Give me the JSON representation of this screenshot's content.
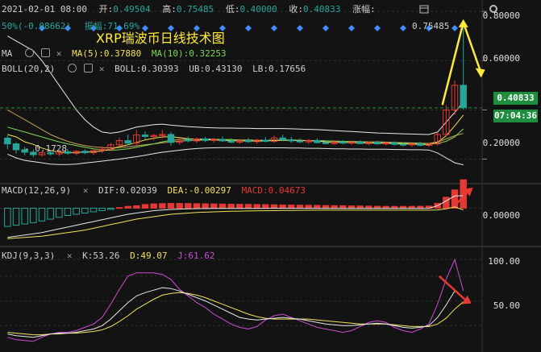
{
  "header": {
    "date": "2021-02-01 08:00",
    "open_label": "开:",
    "open_value": "0.49504",
    "high_label": "高:",
    "high_value": "0.75485",
    "low_label": "低:",
    "low_value": "0.40000",
    "close_label": "收:",
    "close_value": "0.40833",
    "change_label": "涨幅:",
    "change_pct": "50%(-0.08662)",
    "amplitude": "振幅:71.69%"
  },
  "title": "XRP瑞波币日线技术图",
  "ma_row": {
    "label": "MA",
    "ma5": "MA(5):0.37880",
    "ma10": "MA(10):0.32253"
  },
  "boll_row": {
    "label": "BOLL(20,2)",
    "boll": "BOLL:0.30393",
    "ub": "UB:0.43130",
    "lb": "LB:0.17656"
  },
  "macd_row": {
    "label": "MACD(12,26,9)",
    "dif": "DIF:0.02039",
    "dea": "DEA:-0.00297",
    "macd": "MACD:0.04673"
  },
  "kdj_row": {
    "label": "KDJ(9,3,3)",
    "k": "K:53.26",
    "d": "D:49.07",
    "j": "J:61.62"
  },
  "annotations": {
    "high_marker": "0.75485",
    "low_marker": "0.1728"
  },
  "price_tag": {
    "price": "0.40833",
    "countdown": "07:04:36"
  },
  "colors": {
    "up": "#e53935",
    "down": "#26a69a",
    "green_box": "#1e8e3e",
    "yellow": "#ffeb3b",
    "red_arrow": "#e53935"
  },
  "chart_data": [
    {
      "type": "candlestick",
      "title": "XRP瑞波币日线技术图",
      "y_ticks": [
        0.8,
        0.6,
        0.4,
        0.2
      ],
      "y_tick_labels": [
        "0.80000",
        "0.60000",
        "0.40000",
        "0.20000"
      ],
      "ylim": [
        0.12,
        0.82
      ],
      "candles": [
        [
          0.285,
          0.295,
          0.24,
          0.262
        ],
        [
          0.262,
          0.268,
          0.222,
          0.238
        ],
        [
          0.238,
          0.25,
          0.215,
          0.228
        ],
        [
          0.228,
          0.24,
          0.208,
          0.218
        ],
        [
          0.218,
          0.232,
          0.21,
          0.226
        ],
        [
          0.226,
          0.238,
          0.214,
          0.221
        ],
        [
          0.221,
          0.233,
          0.212,
          0.23
        ],
        [
          0.23,
          0.242,
          0.218,
          0.224
        ],
        [
          0.224,
          0.236,
          0.215,
          0.232
        ],
        [
          0.232,
          0.24,
          0.22,
          0.226
        ],
        [
          0.226,
          0.238,
          0.218,
          0.235
        ],
        [
          0.235,
          0.252,
          0.225,
          0.24
        ],
        [
          0.24,
          0.266,
          0.232,
          0.258
        ],
        [
          0.258,
          0.286,
          0.25,
          0.275
        ],
        [
          0.275,
          0.3,
          0.258,
          0.265
        ],
        [
          0.265,
          0.318,
          0.255,
          0.298
        ],
        [
          0.298,
          0.312,
          0.28,
          0.292
        ],
        [
          0.292,
          0.302,
          0.276,
          0.296
        ],
        [
          0.296,
          0.318,
          0.285,
          0.3
        ],
        [
          0.3,
          0.31,
          0.255,
          0.268
        ],
        [
          0.268,
          0.286,
          0.258,
          0.28
        ],
        [
          0.28,
          0.292,
          0.268,
          0.274
        ],
        [
          0.274,
          0.288,
          0.265,
          0.282
        ],
        [
          0.282,
          0.29,
          0.27,
          0.276
        ],
        [
          0.276,
          0.286,
          0.266,
          0.28
        ],
        [
          0.28,
          0.292,
          0.27,
          0.274
        ],
        [
          0.274,
          0.286,
          0.264,
          0.269
        ],
        [
          0.269,
          0.282,
          0.262,
          0.276
        ],
        [
          0.276,
          0.286,
          0.266,
          0.271
        ],
        [
          0.271,
          0.282,
          0.262,
          0.277
        ],
        [
          0.277,
          0.29,
          0.268,
          0.272
        ],
        [
          0.272,
          0.296,
          0.266,
          0.286
        ],
        [
          0.286,
          0.3,
          0.272,
          0.279
        ],
        [
          0.279,
          0.29,
          0.266,
          0.274
        ],
        [
          0.274,
          0.284,
          0.265,
          0.27
        ],
        [
          0.27,
          0.281,
          0.262,
          0.276
        ],
        [
          0.276,
          0.285,
          0.264,
          0.267
        ],
        [
          0.267,
          0.276,
          0.26,
          0.263
        ],
        [
          0.263,
          0.274,
          0.258,
          0.27
        ],
        [
          0.27,
          0.278,
          0.26,
          0.265
        ],
        [
          0.265,
          0.275,
          0.258,
          0.27
        ],
        [
          0.27,
          0.276,
          0.26,
          0.263
        ],
        [
          0.263,
          0.272,
          0.256,
          0.268
        ],
        [
          0.268,
          0.274,
          0.258,
          0.262
        ],
        [
          0.262,
          0.27,
          0.255,
          0.266
        ],
        [
          0.266,
          0.272,
          0.255,
          0.26
        ],
        [
          0.26,
          0.268,
          0.252,
          0.258
        ],
        [
          0.258,
          0.265,
          0.25,
          0.262
        ],
        [
          0.262,
          0.27,
          0.252,
          0.256
        ],
        [
          0.256,
          0.266,
          0.25,
          0.262
        ],
        [
          0.262,
          0.31,
          0.255,
          0.3
        ],
        [
          0.3,
          0.42,
          0.29,
          0.4
        ],
        [
          0.4,
          0.52,
          0.38,
          0.5
        ],
        [
          0.5,
          0.755,
          0.4,
          0.408
        ]
      ],
      "ma5": [
        0.3,
        0.29,
        0.27,
        0.26,
        0.245,
        0.235,
        0.228,
        0.226,
        0.227,
        0.229,
        0.23,
        0.233,
        0.24,
        0.251,
        0.258,
        0.268,
        0.278,
        0.285,
        0.29,
        0.291,
        0.287,
        0.283,
        0.281,
        0.279,
        0.278,
        0.277,
        0.275,
        0.274,
        0.274,
        0.273,
        0.274,
        0.276,
        0.278,
        0.277,
        0.276,
        0.275,
        0.274,
        0.27,
        0.268,
        0.268,
        0.267,
        0.266,
        0.266,
        0.265,
        0.264,
        0.263,
        0.262,
        0.261,
        0.26,
        0.259,
        0.268,
        0.295,
        0.335,
        0.379
      ],
      "ma10": [
        0.33,
        0.32,
        0.31,
        0.3,
        0.29,
        0.28,
        0.27,
        0.262,
        0.255,
        0.248,
        0.242,
        0.238,
        0.236,
        0.238,
        0.242,
        0.248,
        0.255,
        0.262,
        0.27,
        0.276,
        0.279,
        0.281,
        0.282,
        0.282,
        0.281,
        0.28,
        0.279,
        0.277,
        0.276,
        0.275,
        0.275,
        0.275,
        0.276,
        0.276,
        0.276,
        0.275,
        0.275,
        0.274,
        0.273,
        0.272,
        0.271,
        0.27,
        0.269,
        0.268,
        0.267,
        0.266,
        0.265,
        0.264,
        0.263,
        0.262,
        0.264,
        0.272,
        0.29,
        0.323
      ],
      "boll_ub": [
        0.7,
        0.68,
        0.66,
        0.64,
        0.6,
        0.55,
        0.5,
        0.45,
        0.4,
        0.36,
        0.33,
        0.31,
        0.305,
        0.31,
        0.32,
        0.33,
        0.335,
        0.34,
        0.342,
        0.338,
        0.335,
        0.332,
        0.33,
        0.328,
        0.327,
        0.326,
        0.326,
        0.325,
        0.325,
        0.324,
        0.324,
        0.324,
        0.324,
        0.323,
        0.322,
        0.321,
        0.32,
        0.318,
        0.316,
        0.314,
        0.312,
        0.31,
        0.308,
        0.306,
        0.305,
        0.304,
        0.303,
        0.302,
        0.301,
        0.3,
        0.31,
        0.35,
        0.39,
        0.431
      ],
      "boll_mid": [
        0.4,
        0.38,
        0.36,
        0.34,
        0.32,
        0.3,
        0.285,
        0.272,
        0.262,
        0.255,
        0.25,
        0.247,
        0.246,
        0.247,
        0.25,
        0.254,
        0.258,
        0.262,
        0.266,
        0.27,
        0.273,
        0.275,
        0.277,
        0.278,
        0.279,
        0.279,
        0.279,
        0.278,
        0.278,
        0.277,
        0.277,
        0.277,
        0.277,
        0.276,
        0.276,
        0.275,
        0.275,
        0.274,
        0.273,
        0.272,
        0.272,
        0.271,
        0.27,
        0.27,
        0.269,
        0.268,
        0.267,
        0.266,
        0.265,
        0.264,
        0.27,
        0.282,
        0.295,
        0.304
      ],
      "boll_lb": [
        0.22,
        0.205,
        0.195,
        0.19,
        0.185,
        0.18,
        0.178,
        0.178,
        0.18,
        0.184,
        0.188,
        0.192,
        0.196,
        0.2,
        0.205,
        0.21,
        0.216,
        0.222,
        0.228,
        0.232,
        0.236,
        0.24,
        0.243,
        0.245,
        0.246,
        0.247,
        0.247,
        0.247,
        0.247,
        0.246,
        0.246,
        0.246,
        0.246,
        0.245,
        0.245,
        0.244,
        0.244,
        0.243,
        0.242,
        0.242,
        0.241,
        0.241,
        0.24,
        0.24,
        0.24,
        0.239,
        0.239,
        0.238,
        0.238,
        0.237,
        0.225,
        0.205,
        0.185,
        0.177
      ]
    },
    {
      "type": "macd",
      "title": "MACD(12,26,9)",
      "y_ticks": [
        0.0
      ],
      "y_tick_labels": [
        "0.00000"
      ],
      "ylim": [
        -0.055,
        0.035
      ],
      "hist": [
        -0.03,
        -0.028,
        -0.026,
        -0.024,
        -0.021,
        -0.018,
        -0.015,
        -0.012,
        -0.01,
        -0.008,
        -0.006,
        -0.004,
        -0.002,
        0.001,
        0.003,
        0.004,
        0.006,
        0.007,
        0.0075,
        0.0078,
        0.0078,
        0.0076,
        0.0074,
        0.0072,
        0.007,
        0.0068,
        0.0066,
        0.0064,
        0.0062,
        0.006,
        0.0058,
        0.0056,
        0.0054,
        0.0052,
        0.005,
        0.0048,
        0.0046,
        0.0044,
        0.0042,
        0.004,
        0.0038,
        0.0036,
        0.0034,
        0.0032,
        0.003,
        0.003,
        0.003,
        0.003,
        0.0032,
        0.0035,
        0.008,
        0.018,
        0.03,
        0.0467
      ],
      "dif": [
        -0.048,
        -0.046,
        -0.044,
        -0.042,
        -0.04,
        -0.037,
        -0.034,
        -0.031,
        -0.028,
        -0.025,
        -0.022,
        -0.019,
        -0.016,
        -0.013,
        -0.01,
        -0.008,
        -0.006,
        -0.004,
        -0.003,
        -0.002,
        -0.0015,
        -0.001,
        -0.0008,
        -0.0006,
        -0.0005,
        -0.0004,
        -0.0004,
        -0.0004,
        -0.0004,
        -0.0003,
        -0.0003,
        -0.0002,
        -0.0002,
        -0.0002,
        -0.0002,
        -0.0002,
        -0.0002,
        -0.0003,
        -0.0003,
        -0.0003,
        -0.0003,
        -0.0004,
        -0.0004,
        -0.0004,
        -0.0004,
        -0.0005,
        -0.0005,
        -0.0005,
        -0.0004,
        -0.0002,
        0.004,
        0.012,
        0.02,
        0.0204
      ],
      "dea": [
        -0.05,
        -0.049,
        -0.048,
        -0.047,
        -0.046,
        -0.044,
        -0.042,
        -0.04,
        -0.038,
        -0.036,
        -0.033,
        -0.03,
        -0.027,
        -0.024,
        -0.021,
        -0.018,
        -0.016,
        -0.014,
        -0.012,
        -0.01,
        -0.009,
        -0.008,
        -0.007,
        -0.0065,
        -0.006,
        -0.0055,
        -0.005,
        -0.0048,
        -0.0046,
        -0.0044,
        -0.0042,
        -0.004,
        -0.0038,
        -0.0036,
        -0.0035,
        -0.0034,
        -0.0033,
        -0.0033,
        -0.0032,
        -0.0032,
        -0.0032,
        -0.0032,
        -0.0032,
        -0.0032,
        -0.0032,
        -0.0032,
        -0.0032,
        -0.0032,
        -0.0032,
        -0.0032,
        -0.0028,
        -0.001,
        0.002,
        -0.003
      ]
    },
    {
      "type": "kdj",
      "title": "KDJ(9,3,3)",
      "y_ticks": [
        100,
        50
      ],
      "y_tick_labels": [
        "100.00",
        "50.00"
      ],
      "ylim": [
        -5,
        110
      ],
      "k": [
        10,
        8,
        7,
        6,
        8,
        10,
        11,
        11,
        12,
        14,
        16,
        20,
        28,
        38,
        48,
        56,
        60,
        63,
        66,
        65,
        62,
        58,
        54,
        50,
        45,
        40,
        35,
        30,
        28,
        27,
        28,
        29,
        30,
        29,
        28,
        26,
        24,
        22,
        21,
        20,
        20,
        21,
        22,
        23,
        22,
        20,
        18,
        17,
        18,
        20,
        30,
        45,
        62,
        53
      ],
      "d": [
        12,
        11,
        10,
        9,
        9,
        10,
        10,
        11,
        11,
        12,
        13,
        15,
        19,
        25,
        32,
        40,
        46,
        52,
        57,
        59,
        60,
        59,
        57,
        54,
        50,
        46,
        42,
        38,
        34,
        31,
        29,
        28,
        28,
        28,
        28,
        28,
        27,
        26,
        25,
        24,
        23,
        22,
        22,
        22,
        22,
        21,
        20,
        19,
        19,
        19,
        22,
        29,
        40,
        49
      ],
      "j": [
        6,
        3,
        2,
        1,
        6,
        10,
        12,
        12,
        14,
        18,
        22,
        30,
        46,
        64,
        80,
        84,
        84,
        84,
        82,
        76,
        64,
        56,
        48,
        42,
        34,
        28,
        22,
        18,
        16,
        19,
        27,
        32,
        34,
        30,
        26,
        22,
        18,
        16,
        14,
        12,
        14,
        19,
        24,
        26,
        24,
        18,
        14,
        12,
        16,
        22,
        46,
        76,
        100,
        62
      ]
    }
  ]
}
